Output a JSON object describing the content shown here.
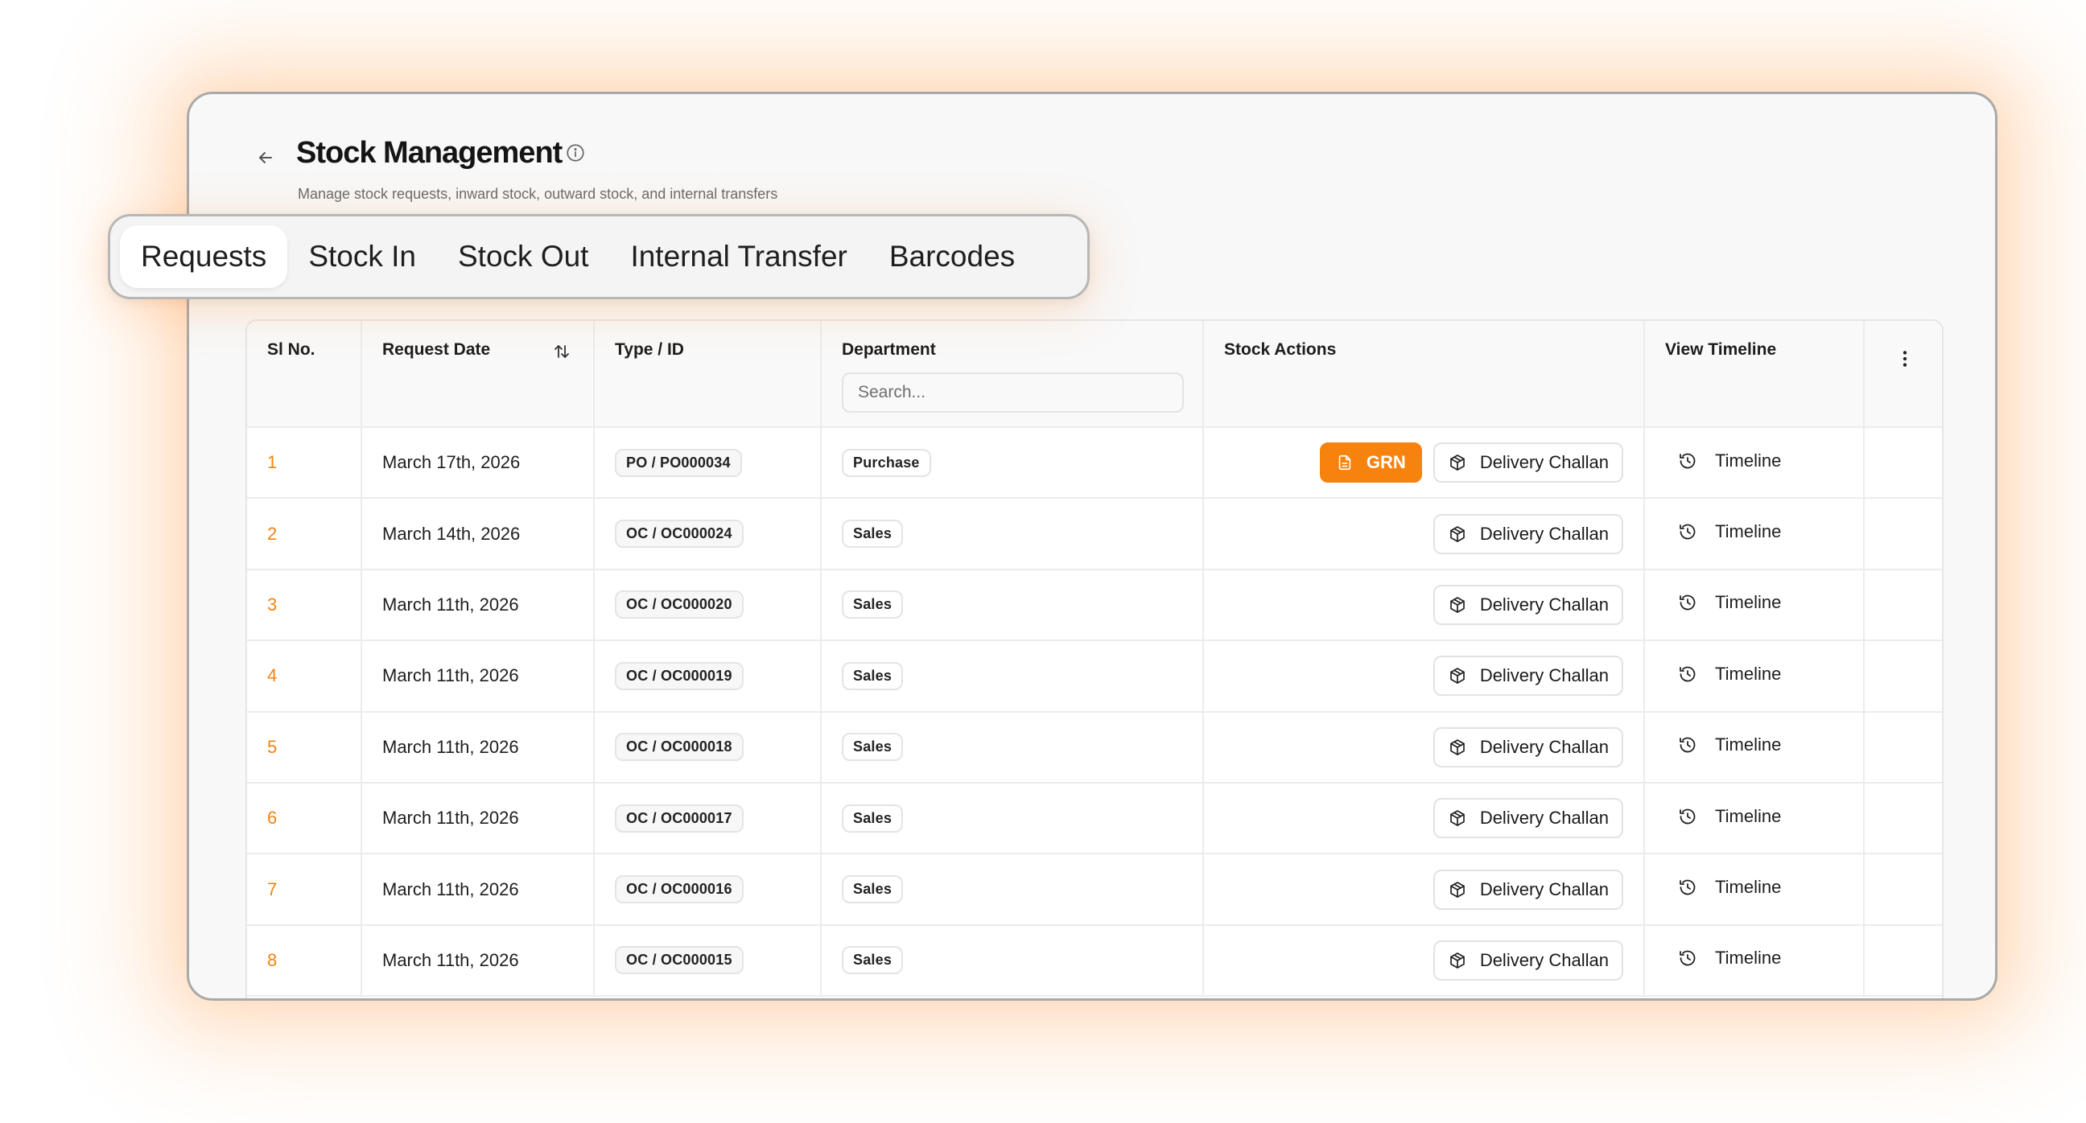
{
  "header": {
    "title": "Stock Management",
    "subtitle": "Manage stock requests, inward stock, outward stock, and internal transfers"
  },
  "tabs": [
    {
      "label": "Requests",
      "active": true
    },
    {
      "label": "Stock In",
      "active": false
    },
    {
      "label": "Stock Out",
      "active": false
    },
    {
      "label": "Internal Transfer",
      "active": false
    },
    {
      "label": "Barcodes",
      "active": false
    }
  ],
  "table": {
    "columns": {
      "sl_no": "Sl No.",
      "request_date": "Request Date",
      "type_id": "Type / ID",
      "department": "Department",
      "stock_actions": "Stock Actions",
      "view_timeline": "View Timeline"
    },
    "department_search_placeholder": "Search...",
    "rows": [
      {
        "sl": "1",
        "date": "March 17th, 2026",
        "type_id": "PO / PO000034",
        "department": "Purchase",
        "grn": "GRN",
        "challan": "Delivery Challan",
        "timeline": "Timeline"
      },
      {
        "sl": "2",
        "date": "March 14th, 2026",
        "type_id": "OC / OC000024",
        "department": "Sales",
        "challan": "Delivery Challan",
        "timeline": "Timeline"
      },
      {
        "sl": "3",
        "date": "March 11th, 2026",
        "type_id": "OC / OC000020",
        "department": "Sales",
        "challan": "Delivery Challan",
        "timeline": "Timeline"
      },
      {
        "sl": "4",
        "date": "March 11th, 2026",
        "type_id": "OC / OC000019",
        "department": "Sales",
        "challan": "Delivery Challan",
        "timeline": "Timeline"
      },
      {
        "sl": "5",
        "date": "March 11th, 2026",
        "type_id": "OC / OC000018",
        "department": "Sales",
        "challan": "Delivery Challan",
        "timeline": "Timeline"
      },
      {
        "sl": "6",
        "date": "March 11th, 2026",
        "type_id": "OC / OC000017",
        "department": "Sales",
        "challan": "Delivery Challan",
        "timeline": "Timeline"
      },
      {
        "sl": "7",
        "date": "March 11th, 2026",
        "type_id": "OC / OC000016",
        "department": "Sales",
        "challan": "Delivery Challan",
        "timeline": "Timeline"
      },
      {
        "sl": "8",
        "date": "March 11th, 2026",
        "type_id": "OC / OC000015",
        "department": "Sales",
        "challan": "Delivery Challan",
        "timeline": "Timeline"
      }
    ]
  },
  "icons": {
    "back": "arrow-left-icon",
    "info": "info-icon",
    "sort": "sort-icon",
    "more": "kebab-menu-icon",
    "grn": "document-icon",
    "challan": "package-icon",
    "timeline": "history-icon"
  },
  "colors": {
    "accent": "#f7830f",
    "sl_number": "#f5820f",
    "glow": "#ff8c28"
  }
}
